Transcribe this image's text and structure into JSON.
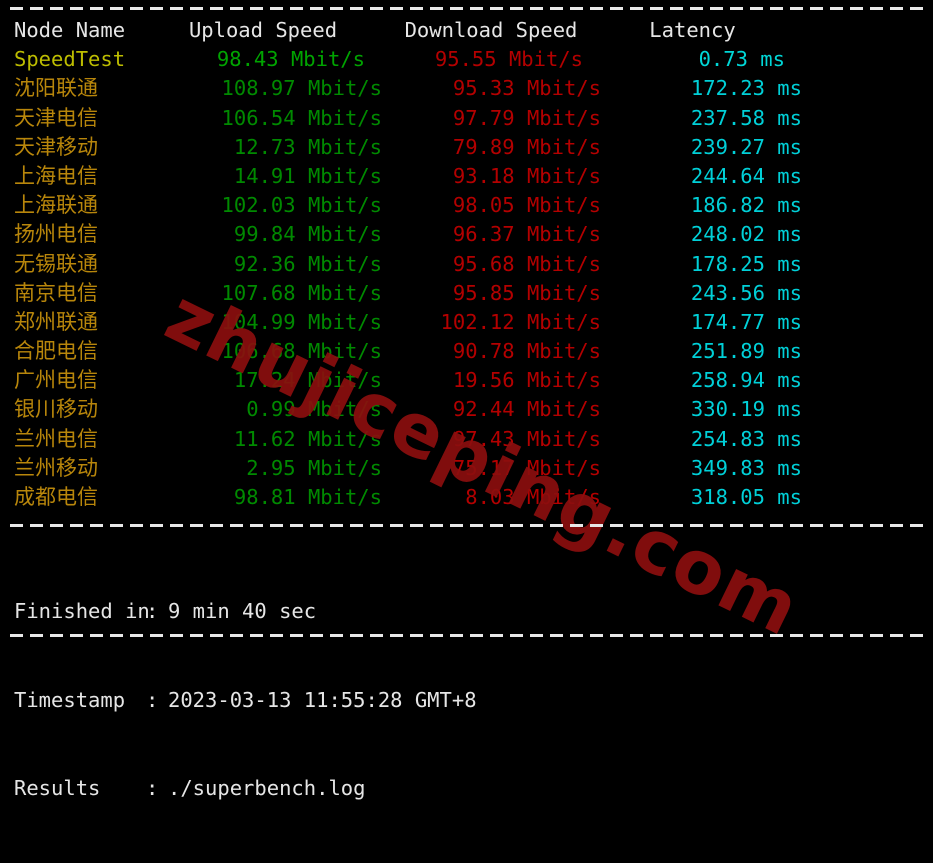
{
  "terminal": {
    "separator_top": "----------------------------------------",
    "separator_middle": "----------------------------------------",
    "separator_bottom": "----------------------------------------"
  },
  "watermark": {
    "text": "zhujiceping.com",
    "color": "#8b0f0f"
  },
  "colors": {
    "background": "#000000",
    "header": "#e6e6e6",
    "node_name": "#b8860b",
    "speedtest_label": "#bdbd00",
    "upload": "#008a00",
    "download": "#b40000",
    "latency": "#00d0d8"
  },
  "table": {
    "headers": {
      "node": "Node Name",
      "upload": "Upload Speed",
      "download": "Download Speed",
      "latency": "Latency"
    },
    "reference_row": {
      "node": "SpeedTest",
      "upload": "98.43 Mbit/s",
      "download": "95.55 Mbit/s",
      "latency": "0.73 ms"
    },
    "rows": [
      {
        "node": "沈阳联通",
        "upload": "108.97 Mbit/s",
        "download": "95.33 Mbit/s",
        "latency": "172.23 ms"
      },
      {
        "node": "天津电信",
        "upload": "106.54 Mbit/s",
        "download": "97.79 Mbit/s",
        "latency": "237.58 ms"
      },
      {
        "node": "天津移动",
        "upload": "12.73 Mbit/s",
        "download": "79.89 Mbit/s",
        "latency": "239.27 ms"
      },
      {
        "node": "上海电信",
        "upload": "14.91 Mbit/s",
        "download": "93.18 Mbit/s",
        "latency": "244.64 ms"
      },
      {
        "node": "上海联通",
        "upload": "102.03 Mbit/s",
        "download": "98.05 Mbit/s",
        "latency": "186.82 ms"
      },
      {
        "node": "扬州电信",
        "upload": "99.84 Mbit/s",
        "download": "96.37 Mbit/s",
        "latency": "248.02 ms"
      },
      {
        "node": "无锡联通",
        "upload": "92.36 Mbit/s",
        "download": "95.68 Mbit/s",
        "latency": "178.25 ms"
      },
      {
        "node": "南京电信",
        "upload": "107.68 Mbit/s",
        "download": "95.85 Mbit/s",
        "latency": "243.56 ms"
      },
      {
        "node": "郑州联通",
        "upload": "104.99 Mbit/s",
        "download": "102.12 Mbit/s",
        "latency": "174.77 ms"
      },
      {
        "node": "合肥电信",
        "upload": "106.68 Mbit/s",
        "download": "90.78 Mbit/s",
        "latency": "251.89 ms"
      },
      {
        "node": "广州电信",
        "upload": "17.24 Mbit/s",
        "download": "19.56 Mbit/s",
        "latency": "258.94 ms"
      },
      {
        "node": "银川移动",
        "upload": "0.99 Mbit/s",
        "download": "92.44 Mbit/s",
        "latency": "330.19 ms"
      },
      {
        "node": "兰州电信",
        "upload": "11.62 Mbit/s",
        "download": "97.43 Mbit/s",
        "latency": "254.83 ms"
      },
      {
        "node": "兰州移动",
        "upload": "2.95 Mbit/s",
        "download": "75.17 Mbit/s",
        "latency": "349.83 ms"
      },
      {
        "node": "成都电信",
        "upload": "98.81 Mbit/s",
        "download": "8.03 Mbit/s",
        "latency": "318.05 ms"
      }
    ]
  },
  "footer": {
    "finished_label": "Finished in",
    "finished_colon": ":",
    "finished_value": "9 min 40 sec",
    "timestamp_label": "Timestamp",
    "timestamp_colon": ":",
    "timestamp_value": "2023-03-13 11:55:28 GMT+8",
    "results_label": "Results",
    "results_colon": ":",
    "results_value": "./superbench.log"
  }
}
